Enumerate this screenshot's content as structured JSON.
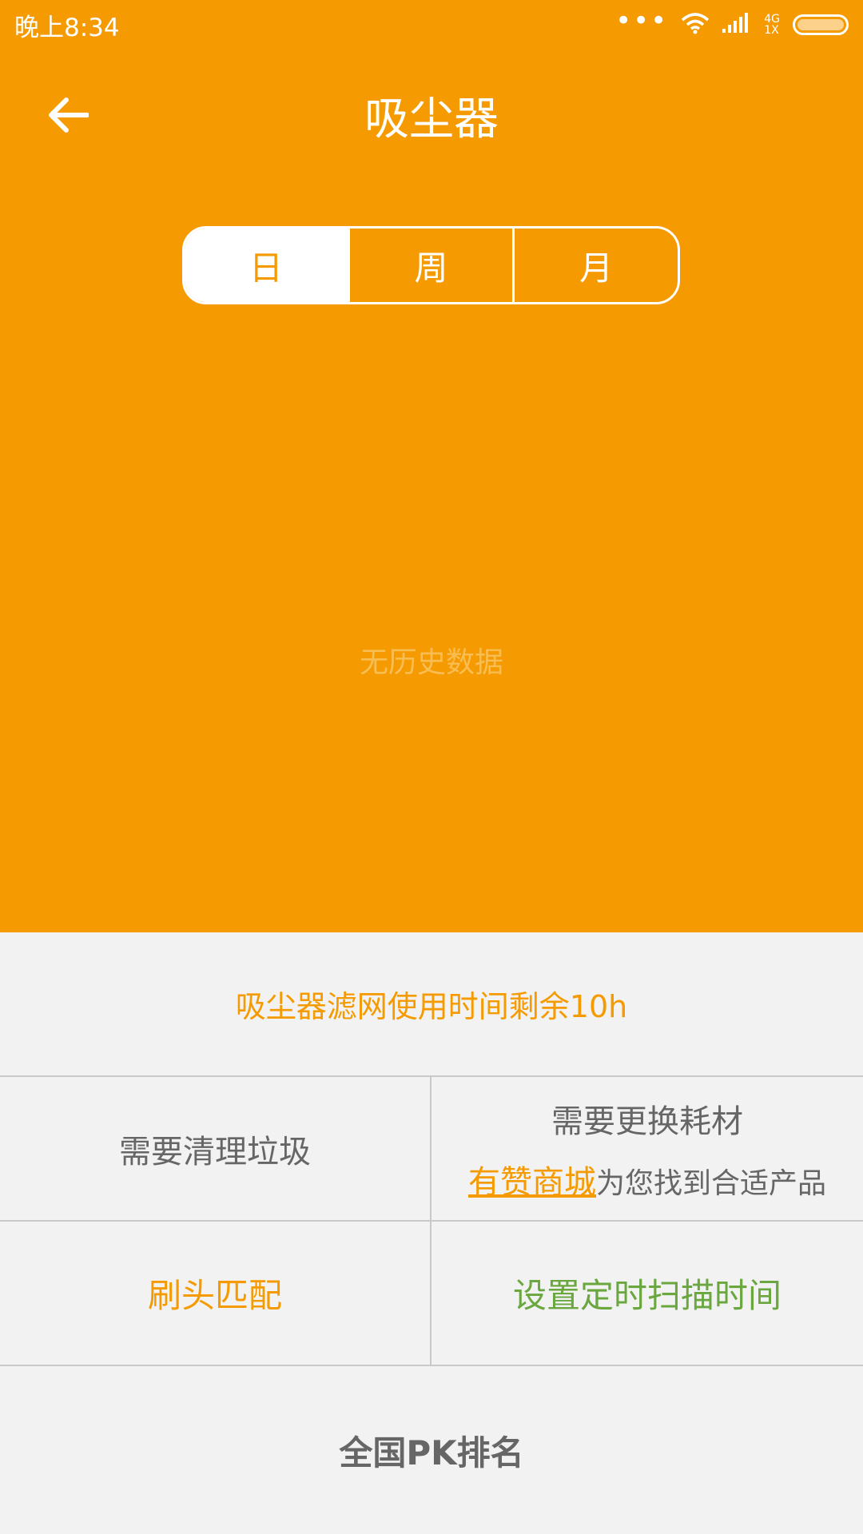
{
  "status_bar": {
    "time": "晚上8:34",
    "dots": "•••",
    "network_top": "4G",
    "network_bottom": "1X",
    "icons": [
      "wifi-icon",
      "signal-icon",
      "battery-icon"
    ]
  },
  "header": {
    "title": "吸尘器",
    "back_icon": "arrow-left-icon"
  },
  "tabs": [
    {
      "label": "日",
      "active": true
    },
    {
      "label": "周",
      "active": false
    },
    {
      "label": "月",
      "active": false
    }
  ],
  "chart": {
    "empty_text": "无历史数据"
  },
  "filter_notice": "吸尘器滤网使用时间剩余10h",
  "grid": {
    "clean_label": "需要清理垃圾",
    "replace_label": "需要更换耗材",
    "mall_link": "有赞商城",
    "mall_suffix": "为您找到合适产品",
    "brush_label": "刷头匹配",
    "schedule_label": "设置定时扫描时间"
  },
  "pk_label": "全国PK排名",
  "colors": {
    "brand_orange": "#f59a00",
    "green": "#6aa73e",
    "gray_text": "#666666",
    "background": "#f2f2f2"
  }
}
